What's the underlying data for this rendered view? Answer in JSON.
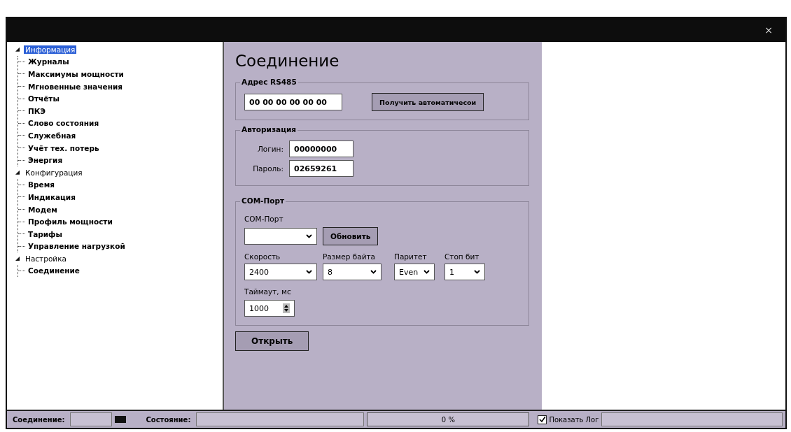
{
  "window": {
    "close": "×"
  },
  "tree": [
    {
      "label": "Информация",
      "selected": true,
      "expanded": true,
      "children": [
        {
          "label": "Журналы",
          "selected": false
        },
        {
          "label": "Максимумы мощности",
          "selected": false
        },
        {
          "label": "Мгновенные значения",
          "selected": false
        },
        {
          "label": "Отчёты",
          "selected": false
        },
        {
          "label": "ПКЭ",
          "selected": false
        },
        {
          "label": "Слово состояния",
          "selected": false
        },
        {
          "label": "Служебная",
          "selected": false
        },
        {
          "label": "Учёт тех. потерь",
          "selected": false
        },
        {
          "label": "Энергия",
          "selected": false
        }
      ]
    },
    {
      "label": "Конфигурация",
      "selected": false,
      "expanded": true,
      "children": [
        {
          "label": "Время",
          "selected": false
        },
        {
          "label": "Индикация",
          "selected": false
        },
        {
          "label": "Модем",
          "selected": false
        },
        {
          "label": "Профиль мощности",
          "selected": false
        },
        {
          "label": "Тарифы",
          "selected": false
        },
        {
          "label": "Управление нагрузкой",
          "selected": false
        }
      ]
    },
    {
      "label": "Настройка",
      "selected": false,
      "expanded": true,
      "children": [
        {
          "label": "Соединение",
          "selected": false
        }
      ]
    }
  ],
  "panel": {
    "title": "Соединение",
    "address": {
      "legend": "Адрес RS485",
      "value": "00 00 00 00 00 00",
      "button": "Получить автоматичесои"
    },
    "auth": {
      "legend": "Авторизация",
      "login_label": "Логин:",
      "login": "00000000",
      "password_label": "Пароль:",
      "password": "02659261"
    },
    "com": {
      "legend": "COM-Порт",
      "port_label": "COM-Порт",
      "refresh": "Обновить",
      "settings": [
        {
          "label": "Скорость",
          "value": "2400"
        },
        {
          "label": "Размер байта",
          "value": "8"
        },
        {
          "label": "Паритет",
          "value": "Even"
        },
        {
          "label": "Стоп бит",
          "value": "1"
        }
      ],
      "timeout_label": "Таймаут, мс",
      "timeout": "1000"
    },
    "open": "Открыть"
  },
  "status_bar": {
    "connection_label": "Соединение:",
    "state_label": "Состояние:",
    "progress": {
      "level": 0,
      "text": "0 %"
    },
    "show_log": {
      "label": "Показать Лог",
      "checked": true
    }
  }
}
